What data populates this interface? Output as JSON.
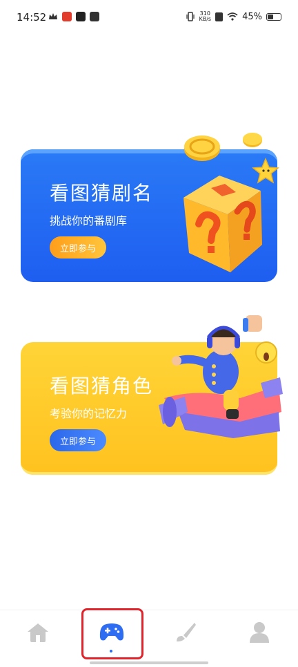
{
  "status_bar": {
    "time": "14:52",
    "net_speed_top": "310",
    "net_speed_bottom": "KB/s",
    "battery": "45%",
    "battery_level": 0.45
  },
  "cards": [
    {
      "title": "看图猜剧名",
      "subtitle": "挑战你的番剧库",
      "button": "立即参与",
      "color": "#1f63f0",
      "illustration": "question-block-icon"
    },
    {
      "title": "看图猜角色",
      "subtitle": "考验你的记忆力",
      "button": "立即参与",
      "color": "#ffc62a",
      "illustration": "pilot-character-icon"
    }
  ],
  "bottom_nav": {
    "items": [
      {
        "icon": "home-icon",
        "active": false
      },
      {
        "icon": "gamepad-icon",
        "active": true
      },
      {
        "icon": "brush-icon",
        "active": false
      },
      {
        "icon": "user-icon",
        "active": false
      }
    ],
    "active_color": "#2e6cf2",
    "inactive_color": "#c9c9c9"
  }
}
